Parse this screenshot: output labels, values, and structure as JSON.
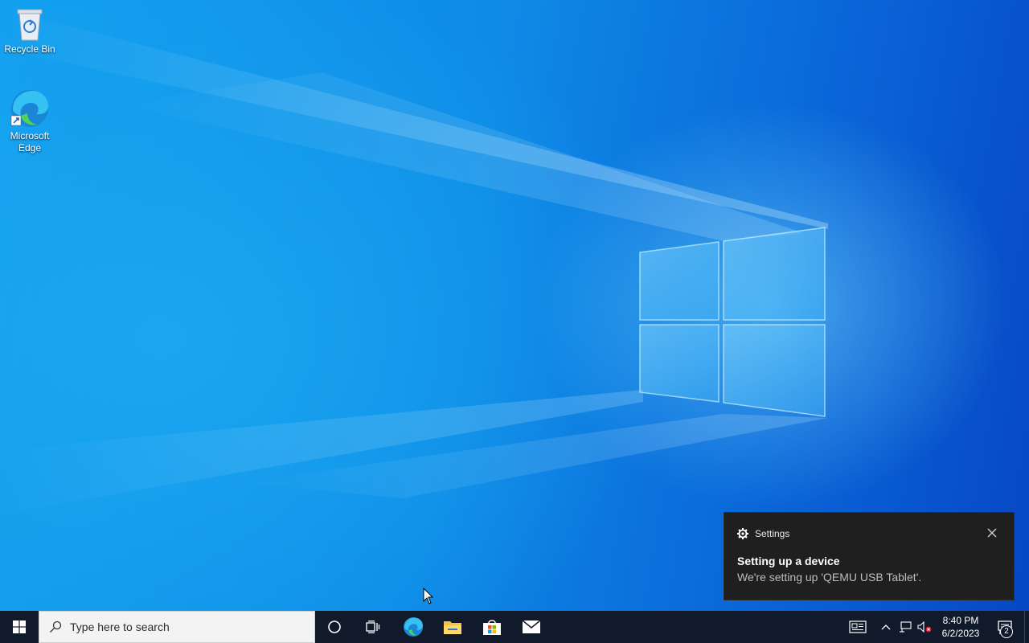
{
  "desktop": {
    "icons": [
      {
        "label": "Recycle Bin",
        "icon": "recycle-bin-icon"
      },
      {
        "label": "Microsoft\nEdge",
        "icon": "edge-icon"
      }
    ]
  },
  "toast": {
    "app": "Settings",
    "app_icon": "gear-icon",
    "title": "Setting up a device",
    "body": "We're setting up 'QEMU USB Tablet'."
  },
  "taskbar": {
    "search_placeholder": "Type here to search",
    "pinned": [
      "cortana-icon",
      "task-view-icon",
      "edge-icon",
      "file-explorer-icon",
      "store-icon",
      "mail-icon"
    ],
    "tray": {
      "time": "8:40 PM",
      "date": "6/2/2023",
      "notification_count": "2"
    }
  },
  "colors": {
    "taskbar": "#101a2a",
    "toast_bg": "#1f1f1f",
    "desktop_accent": "#0a63d6"
  }
}
